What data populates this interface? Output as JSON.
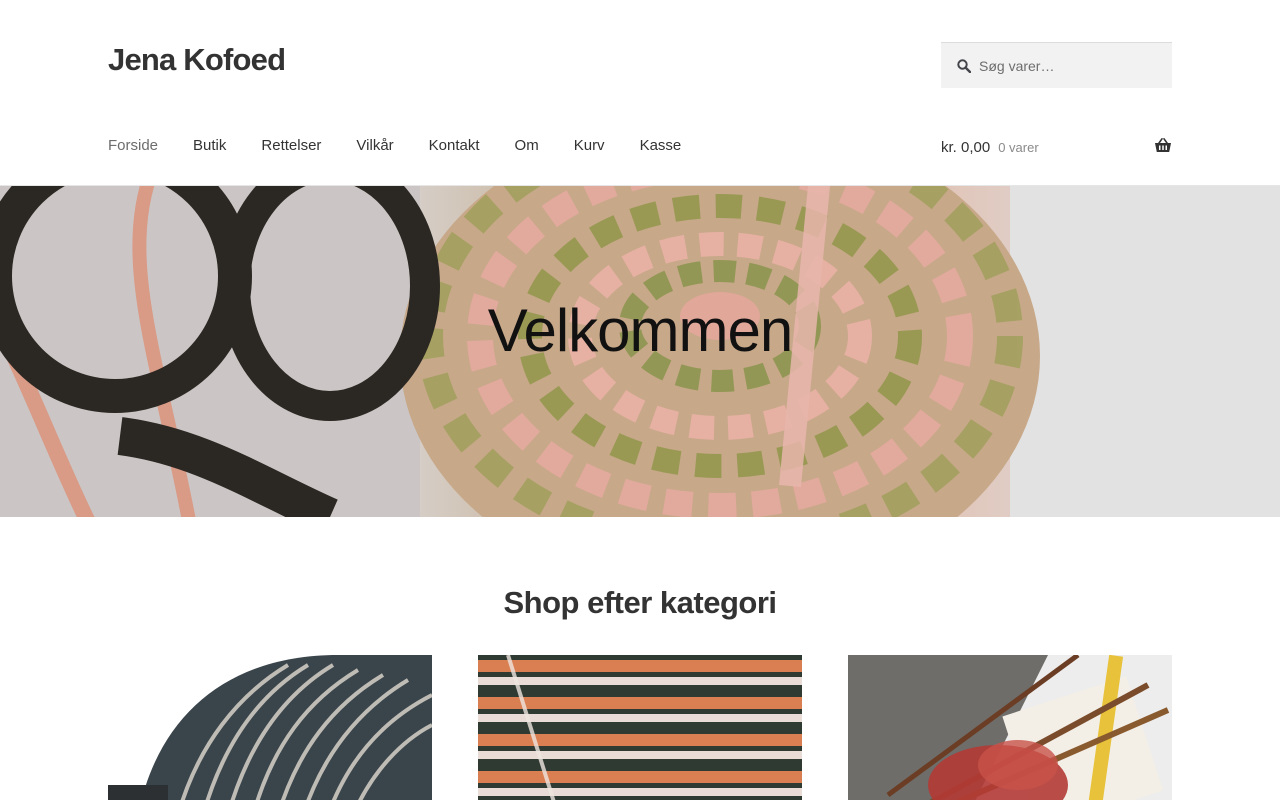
{
  "site": {
    "title": "Jena Kofoed"
  },
  "search": {
    "placeholder": "Søg varer…"
  },
  "nav": {
    "items": [
      {
        "label": "Forside",
        "current": true
      },
      {
        "label": "Butik"
      },
      {
        "label": "Rettelser"
      },
      {
        "label": "Vilkår"
      },
      {
        "label": "Kontakt"
      },
      {
        "label": "Om"
      },
      {
        "label": "Kurv"
      },
      {
        "label": "Kasse"
      }
    ]
  },
  "cart": {
    "amount": "kr. 0,00",
    "count": "0 varer",
    "icon": "basket-icon"
  },
  "hero": {
    "title": "Velkommen",
    "image": "crochet-hat-with-scissors"
  },
  "categories": {
    "title": "Shop efter kategori",
    "items": [
      {
        "image": "striped-dark-hat"
      },
      {
        "image": "orange-green-striped-crochet"
      },
      {
        "image": "knitting-needles-red-yarn"
      }
    ]
  },
  "colors": {
    "text": "#333333",
    "muted": "#6d6d6d",
    "search_bg": "#f2f2f2"
  }
}
